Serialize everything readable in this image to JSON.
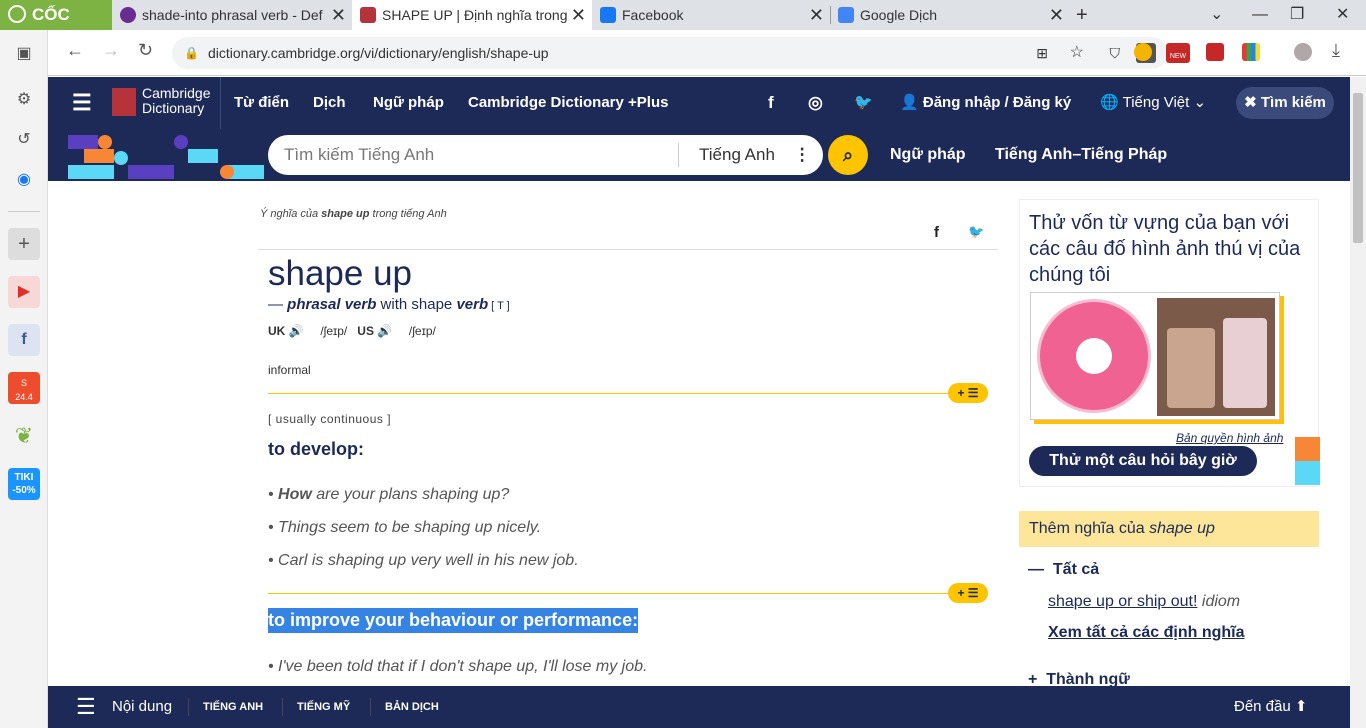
{
  "browser": {
    "logo": "CỐC CỐC",
    "tabs": [
      {
        "title": "shade-into phrasal verb - Def",
        "color": "#6b2c91"
      },
      {
        "title": "SHAPE UP | Định nghĩa trong",
        "color": "#b5343c"
      },
      {
        "title": "Facebook",
        "color": "#1877f2"
      },
      {
        "title": "Google Dịch",
        "color": "#4285f4"
      }
    ],
    "new_tab": "+",
    "url": "dictionary.cambridge.org/vi/dictionary/english/shape-up",
    "ext_badge": "NEW"
  },
  "sidebar": {
    "shopee_badge": "24.4",
    "tiki_label": "TIKI",
    "tiki_discount": "-50%"
  },
  "header": {
    "brand1": "Cambridge",
    "brand2": "Dictionary",
    "nav": [
      "Từ điển",
      "Dịch",
      "Ngữ pháp",
      "Cambridge Dictionary +Plus"
    ],
    "login": "Đăng nhập / Đăng ký",
    "language": "Tiếng Việt",
    "close_search": "Tìm kiếm"
  },
  "search": {
    "placeholder": "Tìm kiếm Tiếng Anh",
    "lang": "Tiếng Anh",
    "link1": "Ngữ pháp",
    "link2": "Tiếng Anh–Tiếng Pháp"
  },
  "entry": {
    "crumb_pre": "Ý nghĩa của ",
    "crumb_word": "shape up",
    "crumb_post": " trong tiếng Anh",
    "headword": "shape up",
    "pos_dash": "— ",
    "pos": "phrasal verb",
    "pos_with": " with shape ",
    "pos_verb": "verb",
    "pos_gram": " [ T ]",
    "uk": "UK",
    "uk_ipa": "/ʃeɪp/",
    "us": "US",
    "us_ipa": "/ʃeɪp/",
    "register": "informal",
    "gram1": "[ usually continuous ]",
    "def1": "to develop:",
    "ex1_bold": "How",
    "ex1_rest": " are your plans shaping up?",
    "ex2": "Things seem to be shaping up nicely.",
    "ex3": "Carl is shaping up very well in his new job.",
    "def2": "to improve your behaviour or performance:",
    "ex4": "I've been told that if I don't shape up, I'll lose my job.",
    "pill": "+ ☰"
  },
  "ad": {
    "title": "Thử vốn từ vựng của bạn với các câu đố hình ảnh thú vị của chúng tôi",
    "credit": "Bản quyền hình ảnh",
    "button": "Thử một câu hỏi bây giờ"
  },
  "more": {
    "pre": "Thêm nghĩa của ",
    "word": "shape up",
    "all": "Tất cả",
    "idiom_link": "shape up or ship out!",
    "idiom_tag": " idiom",
    "see_all": "Xem tất cả các định nghĩa",
    "phrases": "Thành ngữ"
  },
  "footer": {
    "contents": "Nội dung",
    "en": "TIẾNG ANH",
    "us": "TIẾNG MỸ",
    "trans": "BẢN DỊCH",
    "top": "Đến đầu"
  }
}
